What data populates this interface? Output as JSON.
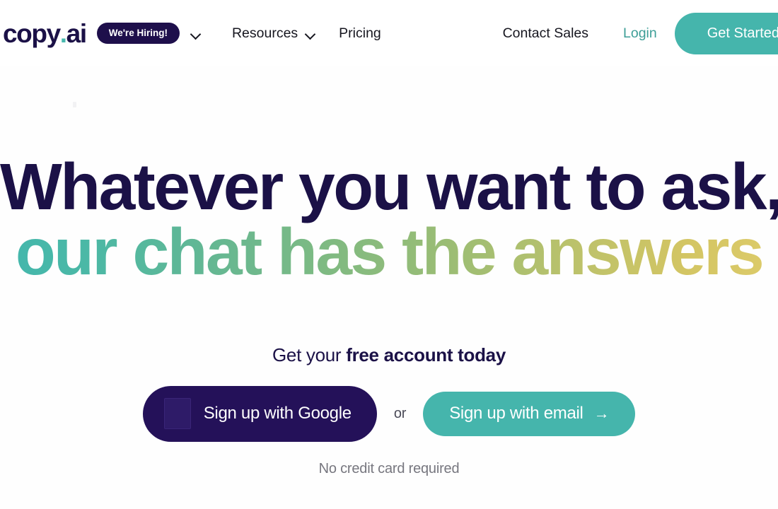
{
  "nav": {
    "logo": {
      "name_main": "copy",
      "dot": ".",
      "name_suffix": "ai"
    },
    "hiring_badge": "We're Hiring!",
    "links": [
      {
        "label": "Resources",
        "has_chevron": true
      },
      {
        "label": "Pricing",
        "has_chevron": false
      }
    ],
    "contact_sales": "Contact Sales",
    "login": "Login",
    "get_started": "Get Started"
  },
  "hero": {
    "headline_line1": "Whatever you want to ask,",
    "headline_line2": "our chat has the answers",
    "subhead_prefix": "Get your ",
    "subhead_bold": "free account today",
    "cta": {
      "google": "Sign up with Google",
      "or": "or",
      "email": "Sign up with email",
      "email_arrow": "→"
    },
    "fine_print": "No credit card required"
  },
  "colors": {
    "brand_navy": "#1b1147",
    "brand_teal": "#45b5ac",
    "badge_navy": "#1e0f4b",
    "google_btn": "#241159",
    "login_teal": "#3d9e97",
    "gradient_start": "#43b7ad",
    "gradient_end": "#d3c563",
    "muted_text": "#77777f",
    "page_bg": "#fefefe"
  }
}
